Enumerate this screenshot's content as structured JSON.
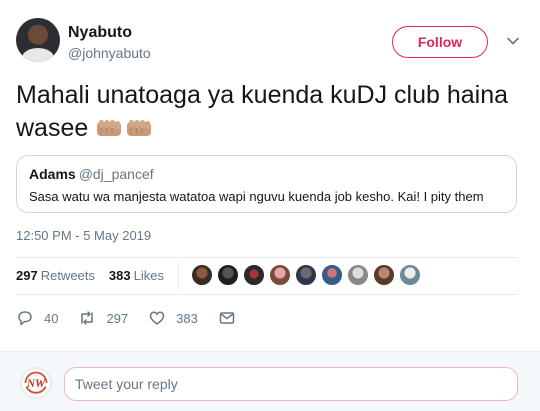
{
  "author": {
    "name": "Nyabuto",
    "handle": "@johnyabuto"
  },
  "follow_label": "Follow",
  "tweet": {
    "text": "Mahali unatoaga ya kuenda kuDJ club haina wasee",
    "emoji": [
      "fist-bump-emoji",
      "fist-bump-emoji"
    ]
  },
  "quote": {
    "name": "Adams",
    "handle": "@dj_pancef",
    "text": "Sasa watu wa manjesta watatoa wapi nguvu kuenda job kesho. Kai! I pity them"
  },
  "timestamp": "12:50 PM - 5 May 2019",
  "stats": {
    "retweets_count": "297",
    "retweets_label": "Retweets",
    "likes_count": "383",
    "likes_label": "Likes"
  },
  "actions": {
    "replies": "40",
    "retweets": "297",
    "likes": "383"
  },
  "reply": {
    "placeholder": "Tweet your reply",
    "avatar_text": "NW"
  },
  "colors": {
    "accent": "#e0245e",
    "muted": "#657786",
    "border": "#e6ecf0"
  }
}
